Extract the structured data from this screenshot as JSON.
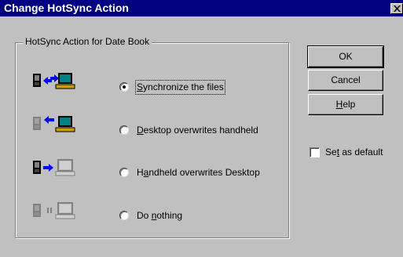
{
  "window": {
    "title": "Change HotSync Action",
    "close_label": "×"
  },
  "group": {
    "label": "HotSync Action for Date Book"
  },
  "options": [
    {
      "pre": "",
      "accel": "S",
      "post": "ynchronize the files",
      "selected": true,
      "icon": "sync-both-icon"
    },
    {
      "pre": "",
      "accel": "D",
      "post": "esktop overwrites handheld",
      "selected": false,
      "icon": "desktop-to-handheld-icon"
    },
    {
      "pre": "H",
      "accel": "a",
      "post": "ndheld overwrites Desktop",
      "selected": false,
      "icon": "handheld-to-desktop-icon"
    },
    {
      "pre": "Do ",
      "accel": "n",
      "post": "othing",
      "selected": false,
      "icon": "do-nothing-icon"
    }
  ],
  "buttons": {
    "ok": "OK",
    "cancel": "Cancel",
    "help_accel": "H",
    "help_rest": "elp"
  },
  "checkbox": {
    "pre": "Se",
    "accel": "t",
    "post": " as default",
    "checked": false
  },
  "colors": {
    "titlebar": "#000080",
    "face": "#c0c0c0",
    "arrow_blue": "#0000ff",
    "screen_teal": "#008080",
    "disabled_gray": "#808080"
  }
}
